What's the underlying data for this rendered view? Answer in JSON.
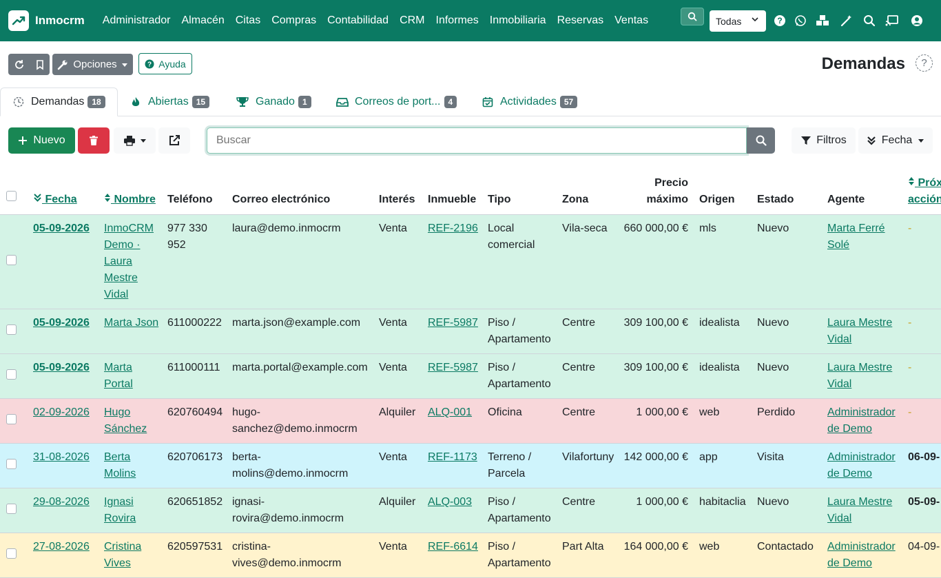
{
  "brand": {
    "name": "Inmocrm"
  },
  "nav": {
    "items": [
      "Administrador",
      "Almacén",
      "Citas",
      "Compras",
      "Contabilidad",
      "CRM",
      "Informes",
      "Inmobiliaria",
      "Reservas",
      "Ventas"
    ],
    "select_value": "Todas"
  },
  "toolbar": {
    "options_label": "Opciones",
    "help_label": "Ayuda"
  },
  "page": {
    "title": "Demandas"
  },
  "tabs": [
    {
      "label": "Demandas",
      "count": "18",
      "icon": "clock-icon"
    },
    {
      "label": "Abiertas",
      "count": "15",
      "icon": "flame-icon"
    },
    {
      "label": "Ganado",
      "count": "1",
      "icon": "trophy-icon"
    },
    {
      "label": "Correos de port...",
      "count": "4",
      "icon": "inbox-icon"
    },
    {
      "label": "Actividades",
      "count": "57",
      "icon": "calendar-check-icon"
    }
  ],
  "actions": {
    "new_label": "Nuevo",
    "search_placeholder": "Buscar",
    "filters_label": "Filtros",
    "sort_label": "Fecha"
  },
  "table": {
    "headers": {
      "fecha": "Fecha",
      "nombre": "Nombre",
      "telefono": "Teléfono",
      "correo": "Correo electrónico",
      "interes": "Interés",
      "inmueble": "Inmueble",
      "tipo": "Tipo",
      "zona": "Zona",
      "precio_1": "Precio",
      "precio_2": "máximo",
      "origen": "Origen",
      "estado": "Estado",
      "agente": "Agente",
      "prox_1": "Próx",
      "prox_2": "acción"
    },
    "rows": [
      {
        "fecha": "05-09-2026",
        "nombre": "InmoCRM Demo · Laura Mestre Vidal",
        "telefono": "977 330 952",
        "correo": "laura@demo.inmocrm",
        "interes": "Venta",
        "inmueble": "REF-2196",
        "tipo": "Local comercial",
        "zona": "Vila-seca",
        "precio": "660 000,00 €",
        "origen": "mls",
        "estado": "Nuevo",
        "agente": "Marta Ferré Solé",
        "prox": "-"
      },
      {
        "fecha": "05-09-2026",
        "nombre": "Marta Json",
        "telefono": "611000222",
        "correo": "marta.json@example.com",
        "interes": "Venta",
        "inmueble": "REF-5987",
        "tipo": "Piso / Apartamento",
        "zona": "Centre",
        "precio": "309 100,00 €",
        "origen": "idealista",
        "estado": "Nuevo",
        "agente": "Laura Mestre Vidal",
        "prox": "-"
      },
      {
        "fecha": "05-09-2026",
        "nombre": "Marta Portal",
        "telefono": "611000111",
        "correo": "marta.portal@example.com",
        "interes": "Venta",
        "inmueble": "REF-5987",
        "tipo": "Piso / Apartamento",
        "zona": "Centre",
        "precio": "309 100,00 €",
        "origen": "idealista",
        "estado": "Nuevo",
        "agente": "Laura Mestre Vidal",
        "prox": "-"
      },
      {
        "fecha": "02-09-2026",
        "nombre": "Hugo Sánchez",
        "telefono": "620760494",
        "correo": "hugo-sanchez@demo.inmocrm",
        "interes": "Alquiler",
        "inmueble": "ALQ-001",
        "tipo": "Oficina",
        "zona": "Centre",
        "precio": "1 000,00 €",
        "origen": "web",
        "estado": "Perdido",
        "agente": "Administrador de Demo",
        "prox": "-"
      },
      {
        "fecha": "31-08-2026",
        "nombre": "Berta Molins",
        "telefono": "620706173",
        "correo": "berta-molins@demo.inmocrm",
        "interes": "Venta",
        "inmueble": "REF-1173",
        "tipo": "Terreno / Parcela",
        "zona": "Vilafortuny",
        "precio": "142 000,00 €",
        "origen": "app",
        "estado": "Visita",
        "agente": "Administrador de Demo",
        "prox": "06-09-"
      },
      {
        "fecha": "29-08-2026",
        "nombre": "Ignasi Rovira",
        "telefono": "620651852",
        "correo": "ignasi-rovira@demo.inmocrm",
        "interes": "Alquiler",
        "inmueble": "ALQ-003",
        "tipo": "Piso / Apartamento",
        "zona": "Centre",
        "precio": "1 000,00 €",
        "origen": "habitaclia",
        "estado": "Nuevo",
        "agente": "Laura Mestre Vidal",
        "prox": "05-09-"
      },
      {
        "fecha": "27-08-2026",
        "nombre": "Cristina Vives",
        "telefono": "620597531",
        "correo": "cristina-vives@demo.inmocrm",
        "interes": "Venta",
        "inmueble": "REF-6614",
        "tipo": "Piso / Apartamento",
        "zona": "Part Alta",
        "precio": "164 000,00 €",
        "origen": "web",
        "estado": "Contactado",
        "agente": "Administrador de Demo",
        "prox": "04-09-"
      }
    ]
  },
  "colors": {
    "brand": "#0b7a63",
    "row_green": "#d4f3e6",
    "row_red": "#f8d7da",
    "row_blue": "#cff4fc",
    "row_yellow": "#fff3cd"
  }
}
